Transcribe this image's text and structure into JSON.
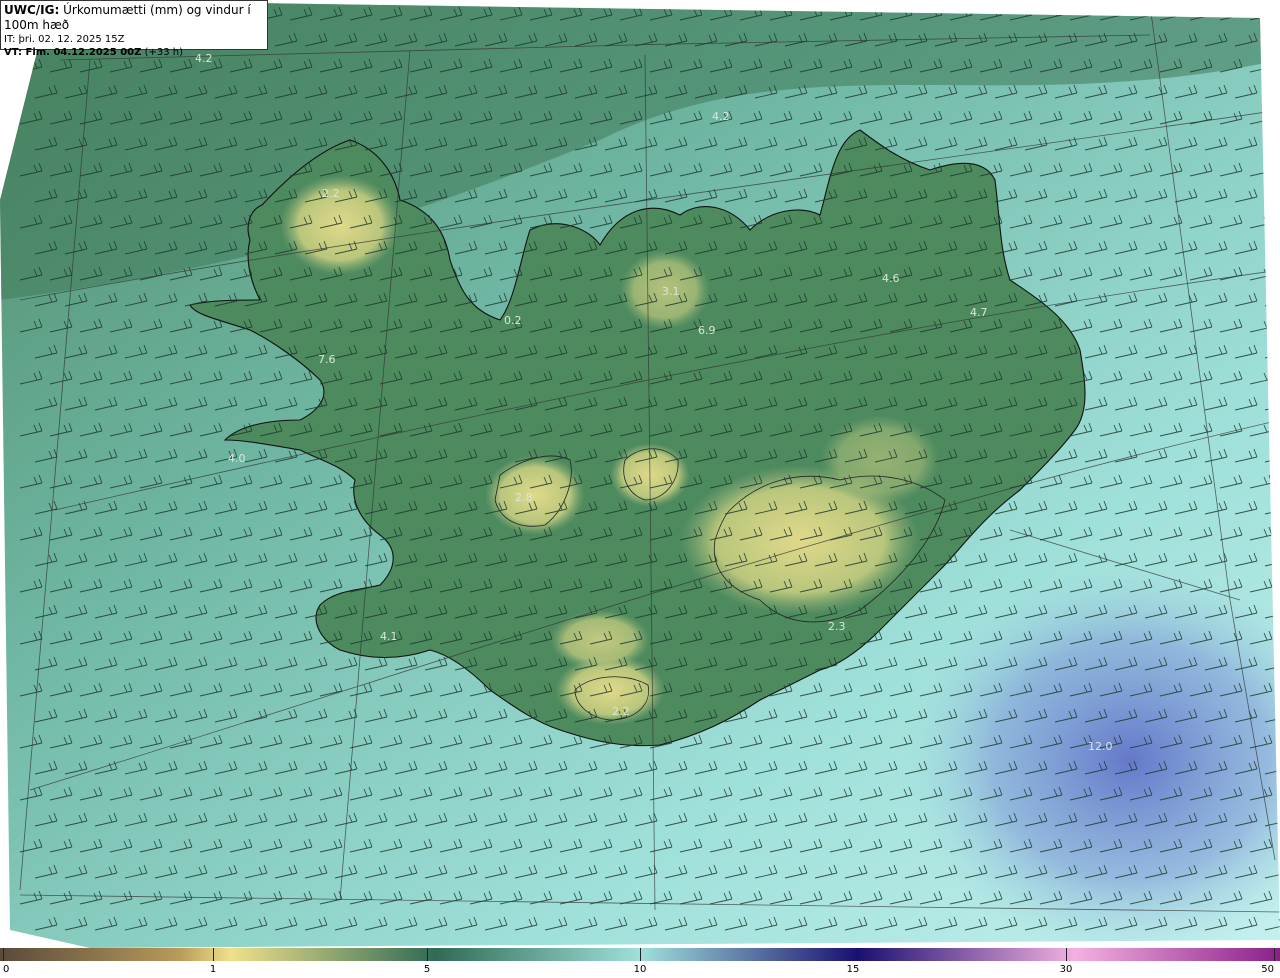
{
  "header": {
    "product_code": "UWC/IG:",
    "product_desc": "Úrkomumætti (mm) og vindur í 100m hæð",
    "init_time": "IT: þri. 02. 12. 2025 15Z",
    "valid_prefix": "VT: Fim. 04.12.2025 00Z",
    "valid_suffix": "(+33 h)"
  },
  "max_labels": [
    "4.2",
    "4.2",
    "2.2",
    "3.1",
    "6.9",
    "4.6",
    "4.7",
    "0.2",
    "7.6",
    "4.0",
    "2.8",
    "4.1",
    "2.3",
    "2.2",
    "12.0"
  ],
  "colorbar": {
    "ticks": [
      "0",
      "1",
      "5",
      "10",
      "15",
      "30",
      "50"
    ],
    "colors": [
      "#5a4a3a",
      "#b89a5a",
      "#f0e08a",
      "#2f6b55",
      "#9fe0da",
      "#1a1070",
      "#f4b0e0",
      "#8a1f8a"
    ]
  },
  "colors": {
    "sea": "#7fc6bd",
    "land": "#5f9a6e",
    "highland": "#c8cf7e",
    "heavy": "#6f8fd0",
    "coast": "#1a1a1a"
  }
}
